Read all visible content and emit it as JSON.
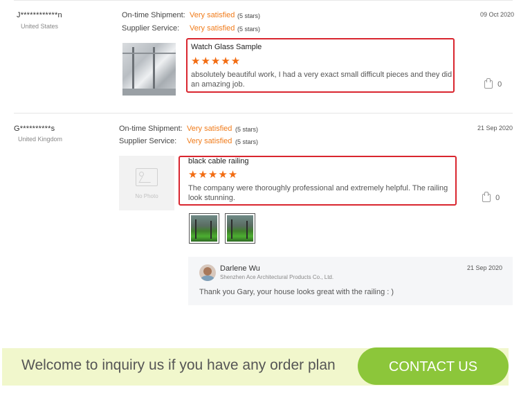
{
  "reviews": [
    {
      "name": "J************n",
      "country": "United States",
      "date": "09 Oct 2020",
      "shipment_label": "On-time Shipment:",
      "shipment_value": "Very satisfied",
      "shipment_stars": "(5 stars)",
      "service_label": "Supplier Service:",
      "service_value": "Very satisfied",
      "service_stars": "(5 stars)",
      "title": "Watch Glass Sample",
      "stars": "★★★★★",
      "rating": 5,
      "text": "absolutely beautiful work, I had a very exact small difficult pieces and they did an amazing job.",
      "likes": "0"
    },
    {
      "name": "G**********s",
      "country": "United Kingdom",
      "date": "21 Sep 2020",
      "shipment_label": "On-time Shipment:",
      "shipment_value": "Very satisfied",
      "shipment_stars": "(5 stars)",
      "service_label": "Supplier Service:",
      "service_value": "Very satisfied",
      "service_stars": "(5 stars)",
      "photo_placeholder": "No Photo",
      "title": "black cable railing",
      "stars": "★★★★★",
      "rating": 5,
      "text": "The company were thoroughly professional and extremely helpful. The railing look stunning.",
      "likes": "0",
      "reply": {
        "name": "Darlene Wu",
        "company": "Shenzhen Ace Architectural Products Co., Ltd.",
        "date": "21 Sep 2020",
        "message": "Thank you Gary, your house looks great with the railing : )"
      }
    }
  ],
  "banner": {
    "text": "Welcome to inquiry us if you have any order plan",
    "cta": "CONTACT US"
  },
  "colors": {
    "accent_orange": "#f07b1a",
    "highlight_red": "#d9252e",
    "cta_green": "#8cc63a",
    "banner_bg": "#f1f7cc"
  }
}
